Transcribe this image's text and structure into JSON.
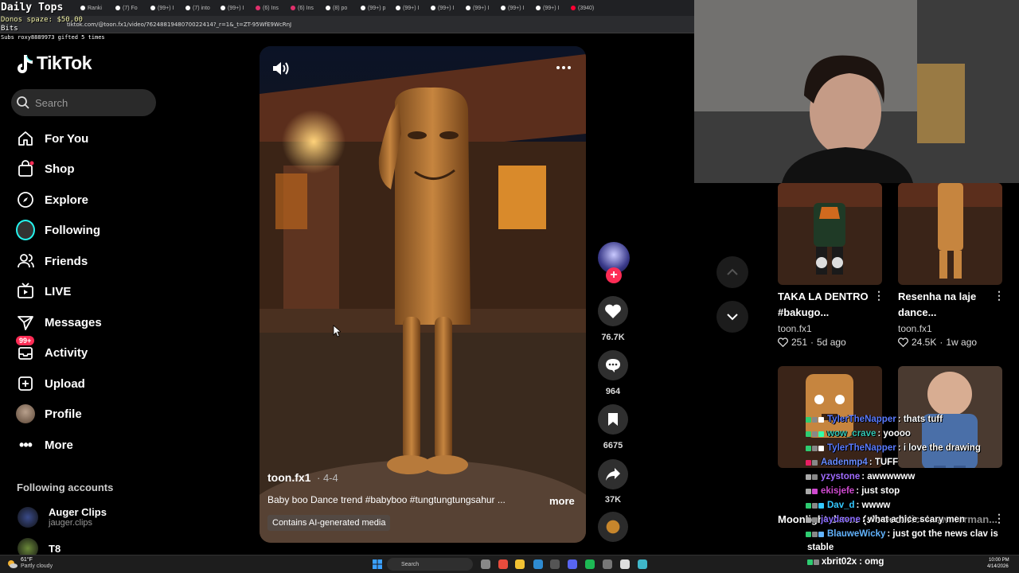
{
  "browser": {
    "tabs": [
      "Ranki",
      "(7) Fo",
      "(99+) I",
      "(7) into",
      "(99+) I",
      "(6) Ins",
      "(6) Ins",
      "(8) po",
      "(99+) p",
      "(99+) I",
      "(99+) I",
      "(99+) I",
      "(99+) I",
      "(99+) I",
      "(3940)"
    ],
    "url": "tiktok.com/@toon.fx1/video/7624881948070022414?_r=1&_t=ZT-95WfE9WcRnJ"
  },
  "stream_overlay": {
    "title": "Daily Tops",
    "donos": "Donos spaze: $50.00",
    "bits": "Bits",
    "subs": "Subs roxy8889973 gifted 5 times"
  },
  "tiktok": {
    "brand": "TikTok",
    "search_placeholder": "Search",
    "nav": [
      {
        "label": "For You",
        "icon": "home-icon"
      },
      {
        "label": "Shop",
        "icon": "shopping-bag-icon"
      },
      {
        "label": "Explore",
        "icon": "compass-icon"
      },
      {
        "label": "Following",
        "icon": "avatar-icon"
      },
      {
        "label": "Friends",
        "icon": "friends-icon"
      },
      {
        "label": "LIVE",
        "icon": "live-tv-icon"
      },
      {
        "label": "Messages",
        "icon": "send-icon"
      },
      {
        "label": "Activity",
        "icon": "inbox-icon",
        "badge": "99+"
      },
      {
        "label": "Upload",
        "icon": "plus-square-icon"
      },
      {
        "label": "Profile",
        "icon": "profile-avatar-icon"
      },
      {
        "label": "More",
        "icon": "ellipsis-icon"
      }
    ],
    "following_header": "Following accounts",
    "following_accounts": [
      {
        "name": "Auger Clips",
        "handle": "jauger.clips"
      },
      {
        "name": "T8",
        "handle": ""
      }
    ],
    "video": {
      "author": "toon.fx1",
      "date": "· 4-4",
      "caption": "Baby boo Dance trend  #babyboo #tungtungtungsahur ...",
      "more": "more",
      "ai_label": "Contains AI-generated media"
    },
    "actions": {
      "likes": "76.7K",
      "comments": "964",
      "saves": "6675",
      "shares": "37K"
    },
    "suggested": [
      {
        "title": "TAKA LA DENTRO #bakugo...",
        "author": "toon.fx1",
        "likes": "251",
        "age": "5d ago"
      },
      {
        "title": "Resenha na laje dance...",
        "author": "toon.fx1",
        "likes": "24.5K",
        "age": "1w ago"
      },
      {
        "title": "Moonlight dance (slowed...",
        "author": "",
        "likes": "",
        "age": ""
      },
      {
        "title": "#Nicolaswaterman...",
        "author": "",
        "likes": "",
        "age": ""
      }
    ]
  },
  "chat": {
    "messages": [
      {
        "user": "TylerTheNapper",
        "text": ": thats tuff",
        "color": "#5b7bff"
      },
      {
        "user": "wow_crave",
        "text": ": yoooo",
        "color": "#36c6b2"
      },
      {
        "user": "TylerTheNapper",
        "text": ": i love the drawing",
        "color": "#5b7bff"
      },
      {
        "user": "Aadenmp4",
        "text": ": TUFF",
        "color": "#6a8cff"
      },
      {
        "user": "yzystone",
        "text": ": awwwwww",
        "color": "#a06bff"
      },
      {
        "user": "ekisjefe",
        "text": ": just stop",
        "color": "#d04ad0"
      },
      {
        "user": "Dav_d",
        "text": ": wwww",
        "color": "#34c9ff"
      },
      {
        "user": "jaydaone",
        "text": ": what a nice scary men",
        "color": "#8a6bff"
      },
      {
        "user": "BlauweWicky",
        "text": ": just got the news clav is",
        "color": "#62b4ff"
      }
    ],
    "continuation": "stable",
    "last": {
      "user": "xbrit02x",
      "text": ": omg"
    }
  },
  "taskbar": {
    "weather_temp": "61°F",
    "weather_desc": "Partly cloudy",
    "search": "Search",
    "time": "10:00 PM",
    "date": "4/14/2026"
  },
  "colors": {
    "accent": "#fe2c55",
    "background": "#000000",
    "panel": "#2a2a2a"
  }
}
